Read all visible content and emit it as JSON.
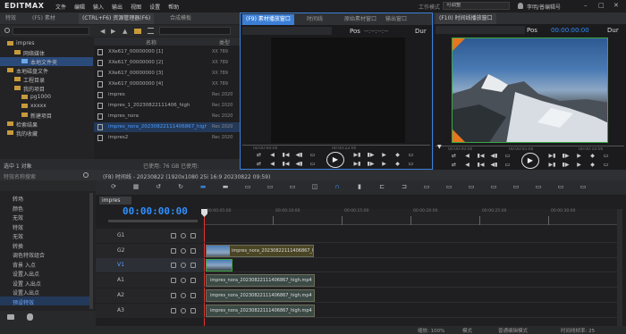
{
  "menubar": {
    "logo": "EDITMAX",
    "menus": [
      "文件",
      "编辑",
      "输入",
      "输出",
      "视图",
      "设置",
      "帮助"
    ],
    "workspace_label": "工作模式",
    "workspace_value": "可调整",
    "user": "李明/普编辑号",
    "window_buttons": [
      "–",
      "□",
      "✕"
    ]
  },
  "left_panel": {
    "tabs": [
      "特效",
      "(F5) 素材",
      "(CTRL+F6) 资源管理器(F6)",
      "合成模板"
    ],
    "tree": [
      "impres",
      "网络媒体",
      "本地文件夹",
      "本地磁盘文件",
      "工程目录",
      "我的项目",
      "pg1000",
      "xxxxx",
      "新建项目",
      "检索结果",
      "我的收藏"
    ],
    "columns": [
      "名称",
      "类型"
    ],
    "files": [
      {
        "name": "XXe617_00000000 [1]",
        "type": "XX 789"
      },
      {
        "name": "XXe617_00000000 [2]",
        "type": "XX 789"
      },
      {
        "name": "XXe617_00000000 [3]",
        "type": "XX 789"
      },
      {
        "name": "XXe617_00000000 [4]",
        "type": "XX 789"
      },
      {
        "name": "impres",
        "type": "Rec 2020"
      },
      {
        "name": "impres_1_20230822111406_high",
        "type": "Rec 2020"
      },
      {
        "name": "impres_nora",
        "type": "Rec 2020"
      },
      {
        "name": "impres_nora_20230822111406867_high",
        "type": "Rec 2020"
      },
      {
        "name": "impres2",
        "type": "Rec 2020"
      }
    ],
    "status_left": "选中 1 对象",
    "status_right": "已使用: 76 GB  已使用:"
  },
  "source_monitor": {
    "title": "(F9) 素材播放窗口",
    "tab2": "时间线",
    "tab3": "原始素材窗口",
    "tab4": "输出窗口",
    "pos_label": "Pos",
    "pos_value": "--:--:--:--",
    "dur_label": "Dur",
    "tc_left": "00:00:00:00",
    "tc_mid": "00:00:22:00"
  },
  "record_monitor": {
    "title": "(F10) 时间线播放窗口",
    "pos_label": "Pos",
    "pos_value": "00:00:00:00",
    "dur_label": "Dur",
    "tc_left": "00:00:00:00",
    "tc_mid": "00:00:05:00",
    "tc_right": "00:00:10:00"
  },
  "effects_panel": {
    "search_placeholder": "特效名称搜索",
    "items": [
      "转场",
      "颜色",
      "无效",
      "特效",
      "无效",
      "转换",
      "调色特效组合",
      "背景 入点",
      "设置入出点",
      "设置 入出点",
      "设置入出点",
      "预设特效"
    ]
  },
  "timeline": {
    "title": "(F8) 时间线 - 20230822 (1920x1080 25i 16:9 20230822 09:59)",
    "sequence": "impres",
    "timecode": "00:00:00:00",
    "ruler": [
      "00:00:05:00",
      "00:00:10:00",
      "00:00:15:00",
      "00:00:20:00",
      "00:00:25:00",
      "00:00:30:00"
    ],
    "tracks": [
      "G1",
      "G2",
      "V1",
      "A1",
      "A2",
      "A3"
    ],
    "clips": [
      {
        "track": "G2",
        "label": "impres_nora_20230822111406867_high.mp4"
      },
      {
        "track": "V1",
        "label": ""
      },
      {
        "track": "A1",
        "label": "impres_nora_20230822111406867_high.mp4"
      },
      {
        "track": "A2",
        "label": "impres_nora_20230822111406867_high.mp4"
      },
      {
        "track": "A3",
        "label": "impres_nora_20230822111406867_high.mp4"
      }
    ],
    "status": [
      "缩放: 100%",
      "模式",
      "普通编辑模式",
      "时间线帧率: 25"
    ]
  },
  "colors": {
    "accent": "#3c7fd6",
    "timecode": "#2f8fff",
    "selection": "#2a4a7a",
    "clip_video": "#4a4524",
    "clip_audio": "#3c4a46",
    "orange": "#e8761e",
    "green_clip": "#3aa845"
  }
}
